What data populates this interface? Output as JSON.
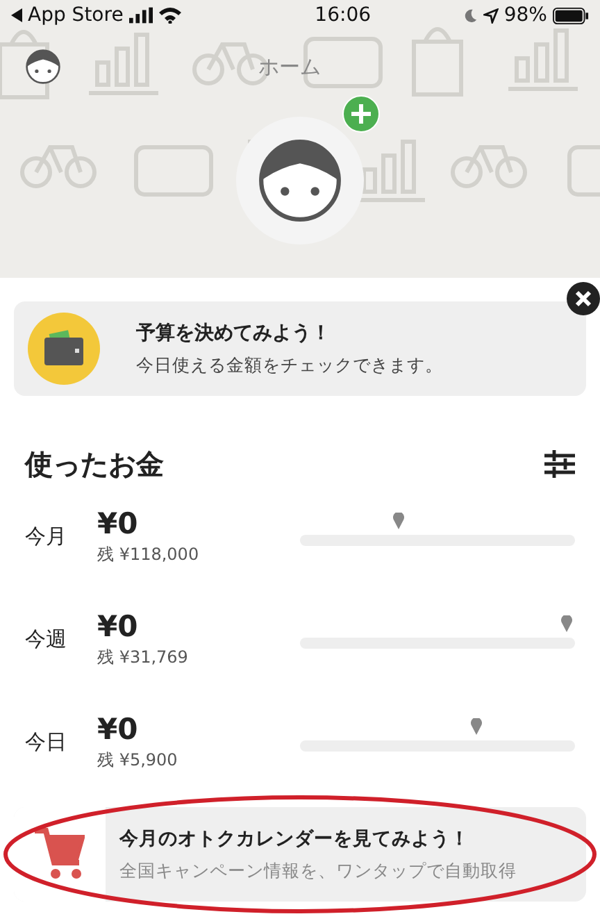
{
  "status_bar": {
    "back_label": "App Store",
    "time": "16:06",
    "battery": "98%"
  },
  "header": {
    "title": "ホーム"
  },
  "budget_card": {
    "title": "予算を決めてみよう！",
    "subtitle": "今日使える金額をチェックできます。"
  },
  "spending": {
    "title": "使ったお金",
    "rows": [
      {
        "period": "今月",
        "amount": "¥0",
        "remaining": "残 ¥118,000",
        "level": 0.36
      },
      {
        "period": "今週",
        "amount": "¥0",
        "remaining": "残 ¥31,769",
        "level": 0.97
      },
      {
        "period": "今日",
        "amount": "¥0",
        "remaining": "残 ¥5,900",
        "level": 0.64
      }
    ]
  },
  "promo_card": {
    "title": "今月のオトクカレンダーを見てみよう！",
    "subtitle": "全国キャンペーン情報を、ワンタップで自動取得",
    "circled": true
  }
}
